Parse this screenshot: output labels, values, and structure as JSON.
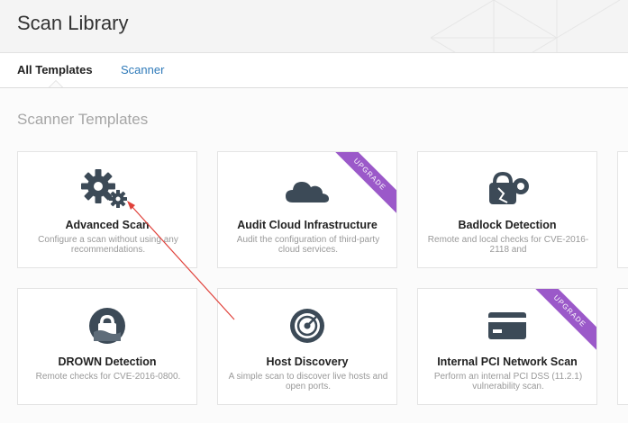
{
  "header": {
    "title": "Scan Library"
  },
  "tabs": [
    {
      "label": "All Templates",
      "active": true
    },
    {
      "label": "Scanner",
      "active": false
    }
  ],
  "section_title": "Scanner Templates",
  "ribbon_label": "UPGRADE",
  "colors": {
    "accent_link": "#2f7ab9",
    "icon_dark": "#3c4a57",
    "upgrade_ribbon": "#9b59c9",
    "annotation_arrow": "#e0413a"
  },
  "templates": [
    {
      "name": "Advanced Scan",
      "desc": "Configure a scan without using any recommendations.",
      "icon": "gears-icon",
      "upgrade": false
    },
    {
      "name": "Audit Cloud Infrastructure",
      "desc": "Audit the configuration of third-party cloud services.",
      "icon": "cloud-icon",
      "upgrade": true
    },
    {
      "name": "Badlock Detection",
      "desc": "Remote and local checks for CVE-2016-2118 and",
      "icon": "badlock-icon",
      "upgrade": false
    },
    {
      "name": "DROWN Detection",
      "desc": "Remote checks for CVE-2016-0800.",
      "icon": "drown-lock-icon",
      "upgrade": false
    },
    {
      "name": "Host Discovery",
      "desc": "A simple scan to discover live hosts and open ports.",
      "icon": "radar-icon",
      "upgrade": false
    },
    {
      "name": "Internal PCI Network Scan",
      "desc": "Perform an internal PCI DSS (11.2.1) vulnerability scan.",
      "icon": "credit-card-icon",
      "upgrade": true
    }
  ]
}
